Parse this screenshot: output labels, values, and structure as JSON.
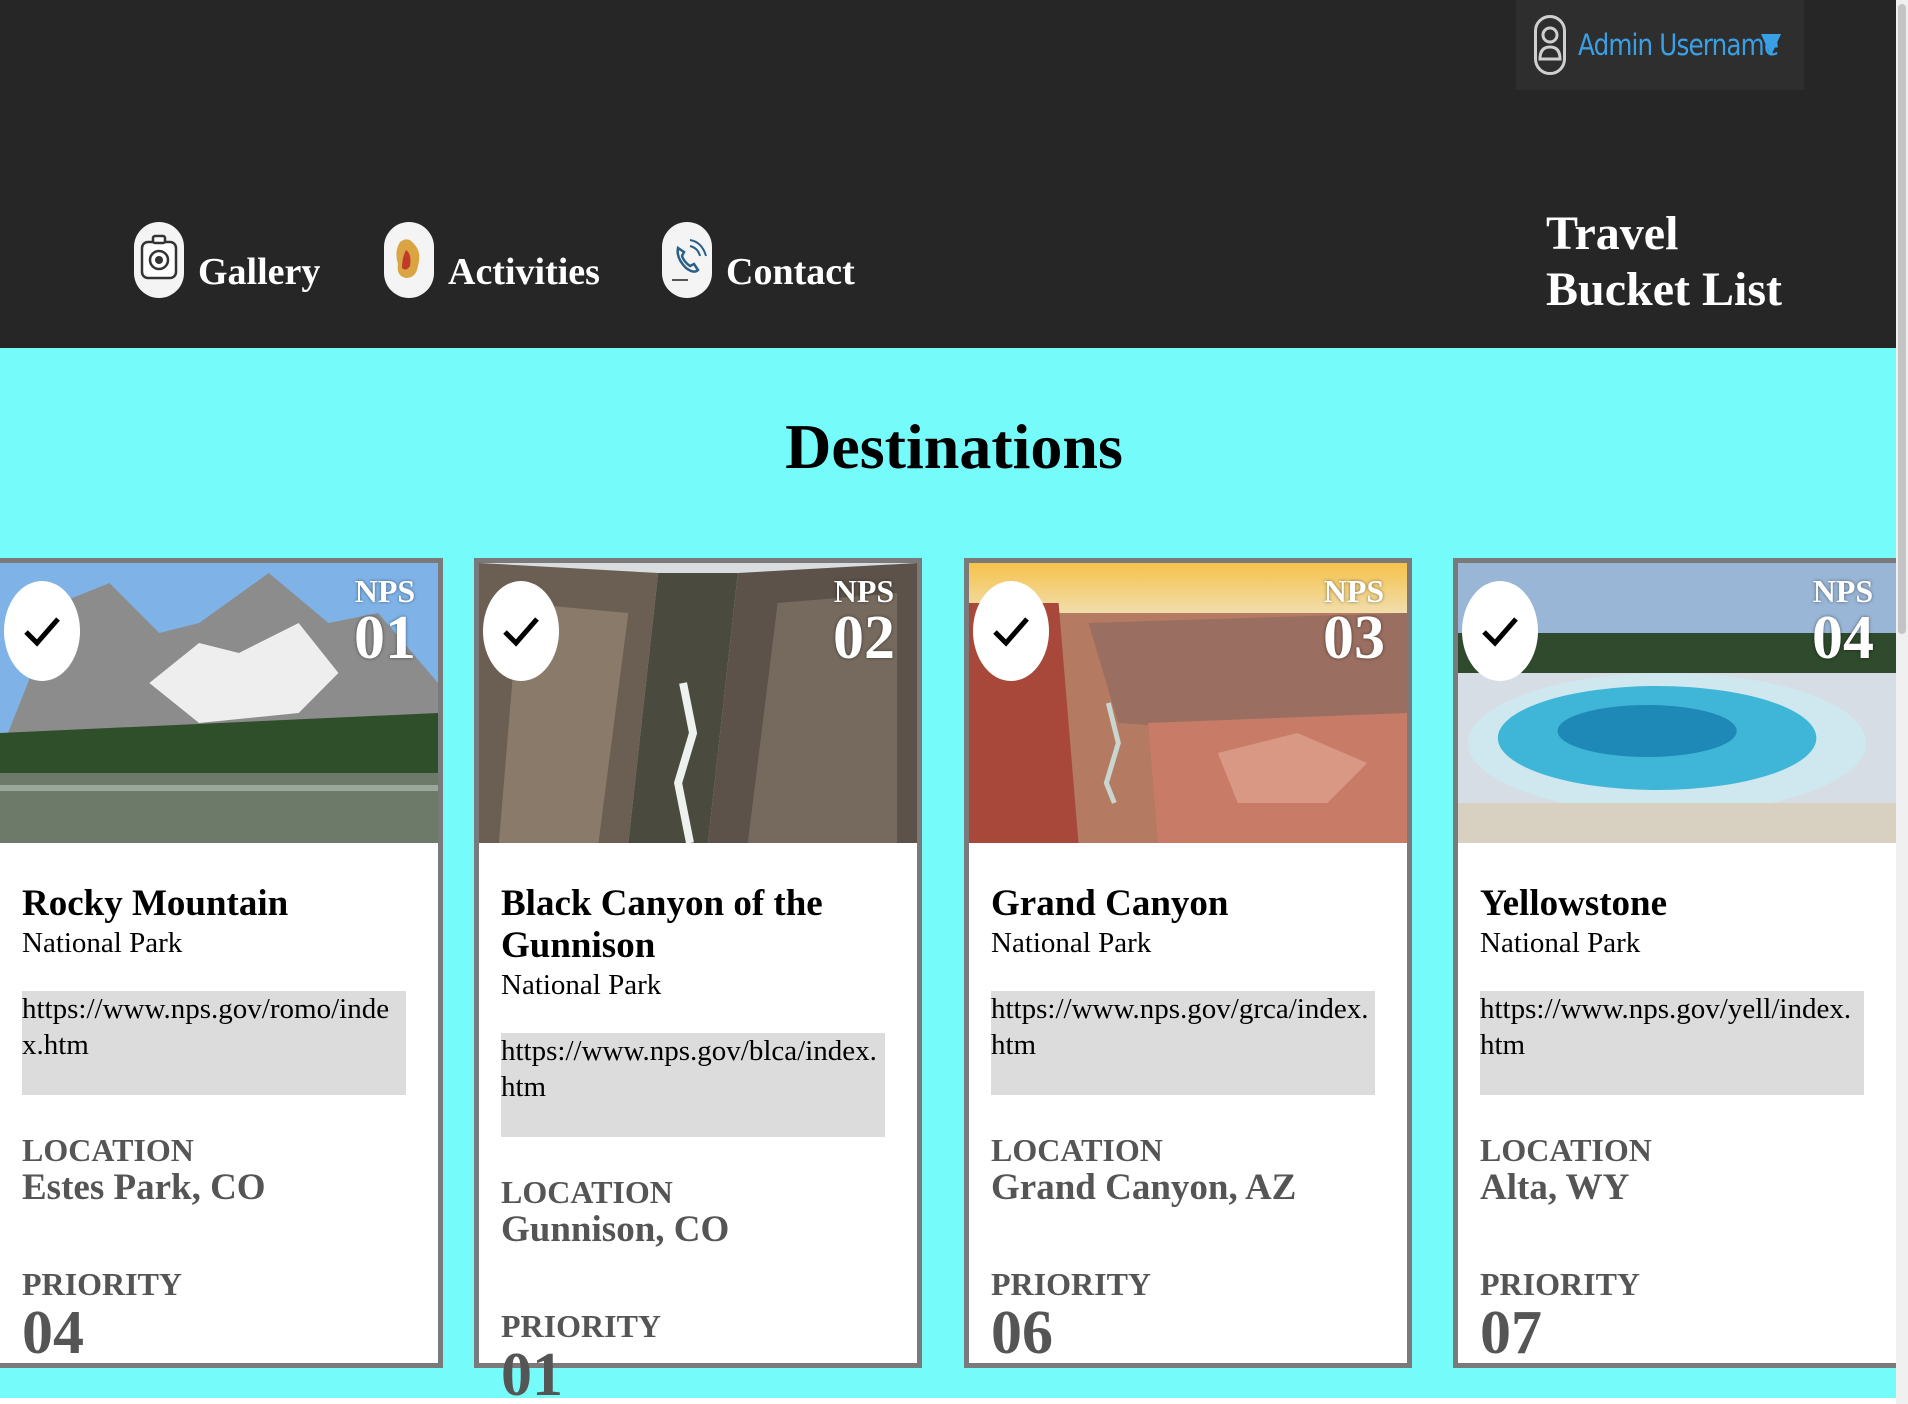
{
  "user_menu": {
    "label": "Admin Username",
    "icon": "user-icon",
    "caret_icon": "caret-down-icon",
    "accent": "#3aa0e6"
  },
  "nav": [
    {
      "label": "Gallery",
      "icon": "camera-icon"
    },
    {
      "label": "Activities",
      "icon": "activities-icon"
    },
    {
      "label": "Contact",
      "icon": "phone-icon"
    }
  ],
  "brand": {
    "line1": "Travel",
    "line2": "Bucket List"
  },
  "page": {
    "heading": "Destinations",
    "background": "#76fbfb",
    "header_background": "#262626"
  },
  "cards": [
    {
      "nps_word": "NPS",
      "nps_number": "01",
      "name": "Rocky Mountain",
      "subtitle": "National Park",
      "url": "https://www.nps.gov/romo/index.htm",
      "location_label": "LOCATION",
      "location": "Estes Park, CO",
      "priority_label": "PRIORITY",
      "priority": "04",
      "checked": true
    },
    {
      "nps_word": "NPS",
      "nps_number": "02",
      "name": "Black Canyon of the Gunnison",
      "subtitle": "National Park",
      "url": "https://www.nps.gov/blca/index.htm",
      "location_label": "LOCATION",
      "location": "Gunnison, CO",
      "priority_label": "PRIORITY",
      "priority": "01",
      "checked": true
    },
    {
      "nps_word": "NPS",
      "nps_number": "03",
      "name": "Grand Canyon",
      "subtitle": "National Park",
      "url": "https://www.nps.gov/grca/index.htm",
      "location_label": "LOCATION",
      "location": "Grand Canyon, AZ",
      "priority_label": "PRIORITY",
      "priority": "06",
      "checked": true
    },
    {
      "nps_word": "NPS",
      "nps_number": "04",
      "name": "Yellowstone",
      "subtitle": "National Park",
      "url": "https://www.nps.gov/yell/index.htm",
      "location_label": "LOCATION",
      "location": "Alta, WY",
      "priority_label": "PRIORITY",
      "priority": "07",
      "checked": true
    }
  ]
}
